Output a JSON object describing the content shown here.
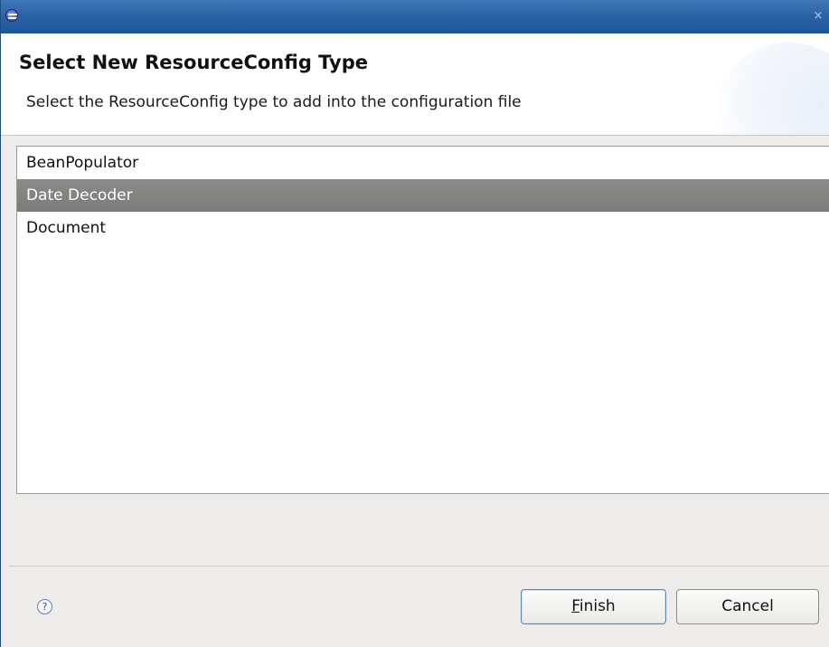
{
  "window": {
    "close_glyph": "×"
  },
  "icons": {
    "app": "eclipse-icon",
    "close": "close-icon",
    "help": "help-icon"
  },
  "banner": {
    "title": "Select New ResourceConfig Type",
    "description": "Select the ResourceConfig type to add into the configuration file"
  },
  "list": {
    "items": [
      {
        "label": "BeanPopulator",
        "selected": false
      },
      {
        "label": "Date Decoder",
        "selected": true
      },
      {
        "label": "Document",
        "selected": false
      }
    ]
  },
  "footer": {
    "help_glyph": "?",
    "finish": {
      "mnemonic": "F",
      "rest": "inish"
    },
    "cancel_label": "Cancel"
  },
  "colors": {
    "titlebar": "#2d64a7",
    "selection": "#7c7b79",
    "dialog_background": "#edeceb"
  }
}
